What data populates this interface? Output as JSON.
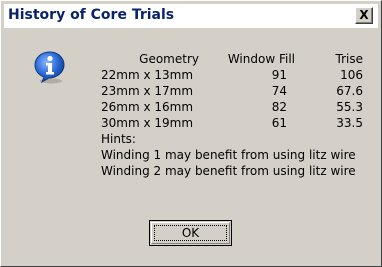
{
  "window": {
    "title": "History of Core Trials",
    "close_label": "X"
  },
  "icon": "info-icon",
  "table": {
    "headers": {
      "geometry": "Geometry",
      "window_fill": "Window Fill",
      "trise": "Trise"
    },
    "rows": [
      {
        "geometry": "22mm x 13mm",
        "window_fill": "91",
        "trise": "106"
      },
      {
        "geometry": "23mm x 17mm",
        "window_fill": "74",
        "trise": "67.6"
      },
      {
        "geometry": "26mm x 16mm",
        "window_fill": "82",
        "trise": "55.3"
      },
      {
        "geometry": "30mm x 19mm",
        "window_fill": "61",
        "trise": "33.5"
      }
    ]
  },
  "hints": {
    "label": "Hints:",
    "lines": [
      "Winding 1 may benefit from using litz wire",
      "Winding 2 may benefit from using litz wire"
    ]
  },
  "buttons": {
    "ok_label": "OK"
  },
  "colors": {
    "dialog_bg": "#d4d0c8",
    "title_text": "#0a246a",
    "icon_blue": "#1c5fd6"
  }
}
